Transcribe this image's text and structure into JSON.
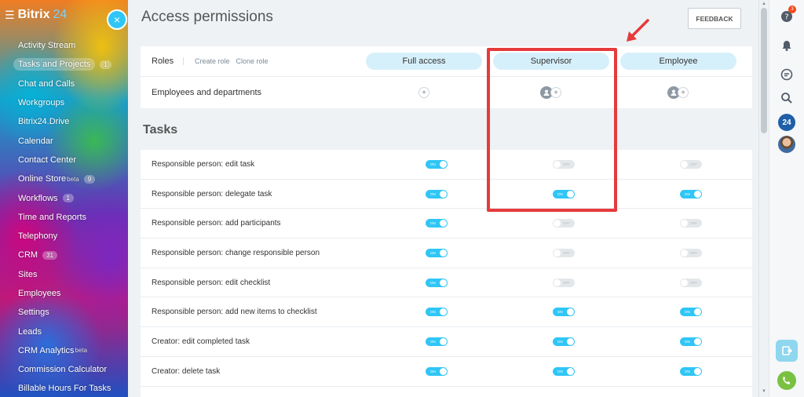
{
  "sidebar": {
    "logo_text": "Bitrix",
    "logo_num": "24",
    "items": [
      {
        "label": "Activity Stream"
      },
      {
        "label": "Tasks and Projects",
        "count": "1",
        "active": true
      },
      {
        "label": "Chat and Calls"
      },
      {
        "label": "Workgroups"
      },
      {
        "label": "Bitrix24.Drive"
      },
      {
        "label": "Calendar"
      },
      {
        "label": "Contact Center"
      },
      {
        "label": "Online Store",
        "sup": "beta",
        "count": "9"
      },
      {
        "label": "Workflows",
        "count": "1"
      },
      {
        "label": "Time and Reports"
      },
      {
        "label": "Telephony"
      },
      {
        "label": "CRM",
        "count": "31"
      },
      {
        "label": "Sites"
      },
      {
        "label": "Employees"
      },
      {
        "label": "Settings"
      },
      {
        "label": "Leads"
      },
      {
        "label": "CRM Analytics",
        "sup": "beta"
      },
      {
        "label": "Commission Calculator"
      },
      {
        "label": "Billable Hours For Tasks"
      }
    ],
    "close_symbol": "×"
  },
  "header": {
    "title": "Access permissions",
    "feedback_label": "FEEDBACK"
  },
  "roles": {
    "label": "Roles",
    "create_role": "Create role",
    "clone_role": "Clone role",
    "columns": [
      "Full access",
      "Supervisor",
      "Employee"
    ],
    "employees_label": "Employees and departments"
  },
  "tasks": {
    "heading": "Tasks",
    "on_text": "ON",
    "off_text": "OFF",
    "rows": [
      {
        "label": "Responsible person: edit task",
        "values": [
          true,
          false,
          false
        ]
      },
      {
        "label": "Responsible person: delegate task",
        "values": [
          true,
          true,
          true
        ]
      },
      {
        "label": "Responsible person: add participants",
        "values": [
          true,
          false,
          false
        ]
      },
      {
        "label": "Responsible person: change responsible person",
        "values": [
          true,
          false,
          false
        ]
      },
      {
        "label": "Responsible person: edit checklist",
        "values": [
          true,
          false,
          false
        ]
      },
      {
        "label": "Responsible person: add new items to checklist",
        "values": [
          true,
          true,
          true
        ]
      },
      {
        "label": "Creator: edit completed task",
        "values": [
          true,
          true,
          true
        ]
      },
      {
        "label": "Creator: delete task",
        "values": [
          true,
          true,
          true
        ]
      }
    ]
  },
  "rail": {
    "help_badge": "3",
    "b24_label": "24"
  },
  "colors": {
    "accent": "#2fc6f6",
    "highlight": "#e53b3b",
    "pill": "#d6f0fb"
  }
}
